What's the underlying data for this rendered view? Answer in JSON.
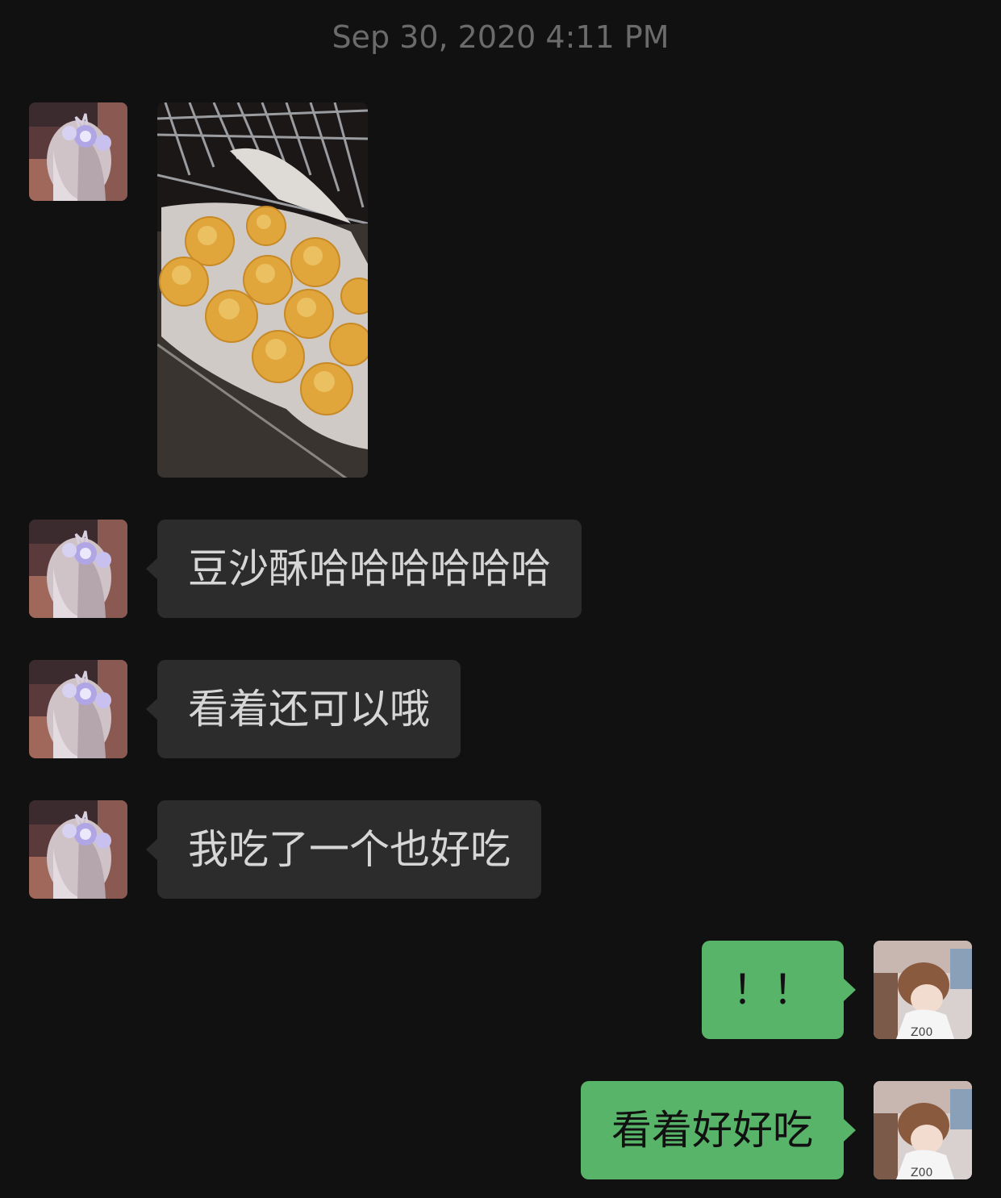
{
  "chat": {
    "timestamp": "Sep 30, 2020 4:11 PM",
    "messages": [
      {
        "sender": "contact",
        "type": "image",
        "image_desc": "baked-pastries-photo"
      },
      {
        "sender": "contact",
        "type": "text",
        "text": "豆沙酥哈哈哈哈哈哈"
      },
      {
        "sender": "contact",
        "type": "text",
        "text": "看着还可以哦"
      },
      {
        "sender": "contact",
        "type": "text",
        "text": "我吃了一个也好吃"
      },
      {
        "sender": "me",
        "type": "text",
        "text": "！！"
      },
      {
        "sender": "me",
        "type": "text",
        "text": "看着好好吃"
      }
    ]
  },
  "colors": {
    "background": "#111111",
    "incoming_bubble": "#2c2c2c",
    "outgoing_bubble": "#58b468",
    "timestamp": "#6b6b6b"
  }
}
